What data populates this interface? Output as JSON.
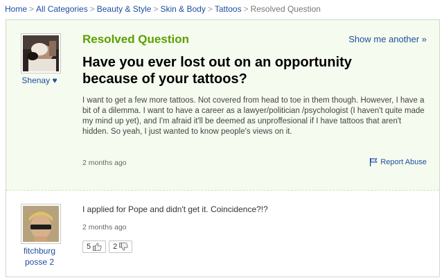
{
  "breadcrumb": {
    "items": [
      "Home",
      "All Categories",
      "Beauty & Style",
      "Skin & Body",
      "Tattoos"
    ],
    "current": "Resolved Question",
    "separator": ">"
  },
  "question": {
    "status": "Resolved Question",
    "show_another": "Show me another »",
    "title": "Have you ever lost out on an opportunity because of your tattoos?",
    "body": "I want to get a few more tattoos. Not covered from head to toe in them though. However, I have a bit of a dilemma. I want to have a career as a lawyer/politician /psychologist (I haven't quite made my mind up yet), and I'm afraid it'll be deemed as unproffesional if I have tattoos that aren't hidden. So yeah, I just wanted to know people's views on it.",
    "time": "2 months ago",
    "report_abuse": "Report Abuse",
    "asker": "Shenay ♥"
  },
  "answer": {
    "author_line1": "fitchburg",
    "author_line2": "posse 2",
    "text": "I applied for Pope and didn't get it. Coincidence?!?",
    "time": "2 months ago",
    "thumbs_up": "5",
    "thumbs_down": "2"
  },
  "colors": {
    "link": "#1b4e9e",
    "resolved": "#5aa000",
    "question_bg": "#f6fbef"
  }
}
